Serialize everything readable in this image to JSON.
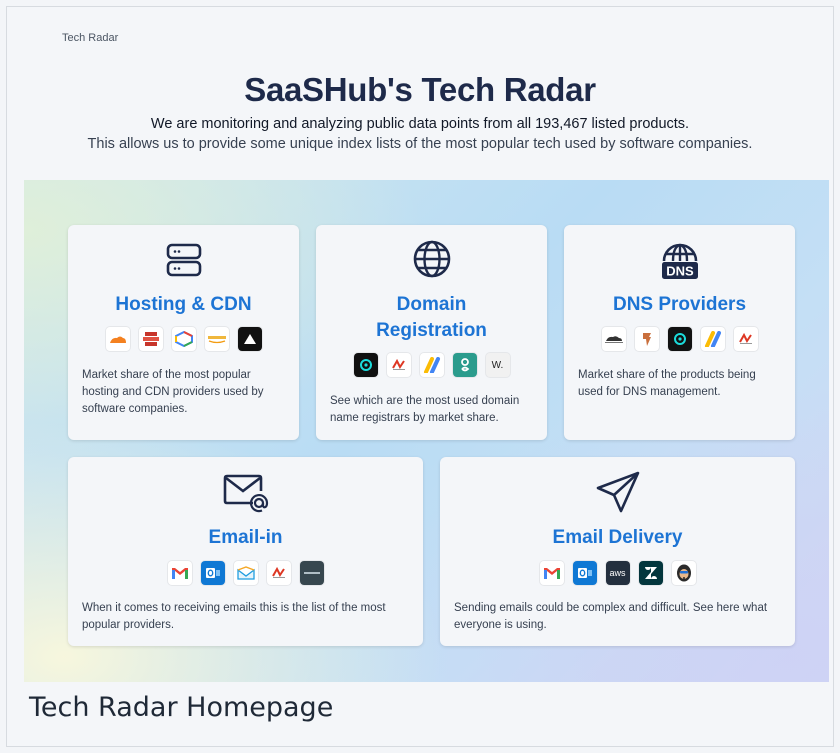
{
  "breadcrumb": "Tech Radar",
  "hero": {
    "title": "SaaSHub's Tech Radar",
    "subtitle1": "We are monitoring and analyzing public data points from all 193,467 listed products.",
    "subtitle2": "This allows us to provide some unique index lists of the most popular tech used by software companies."
  },
  "cards": {
    "hosting": {
      "icon": "server-icon",
      "title": "Hosting & CDN",
      "logos": [
        "cloudflare",
        "aws-s3",
        "google-cloud",
        "amazon-web-services",
        "vercel"
      ],
      "desc": "Market share of the most popular hosting and CDN providers used by software companies."
    },
    "domain": {
      "icon": "globe-icon",
      "title_line1": "Domain",
      "title_line2": "Registration",
      "logos": [
        "godaddy",
        "namecheap",
        "google-domains",
        "gandi",
        "w-registrar"
      ],
      "logo_w_text": "W.",
      "desc": "See which are the most used domain name registrars by market share."
    },
    "dns": {
      "icon": "dns-globe-icon",
      "icon_text": "DNS",
      "title": "DNS Providers",
      "logos": [
        "cloudflare",
        "linode",
        "godaddy",
        "google-domains",
        "namecheap"
      ],
      "desc": "Market share of the products being used for DNS management."
    },
    "email_in": {
      "icon": "email-at-icon",
      "title": "Email-in",
      "logos": [
        "gmail",
        "outlook",
        "protonmail",
        "namecheap",
        "proofpoint"
      ],
      "desc": "When it comes to receiving emails this is the list of the most popular providers."
    },
    "email_delivery": {
      "icon": "paper-plane-icon",
      "title": "Email Delivery",
      "logos": [
        "gmail",
        "outlook",
        "aws",
        "zendesk",
        "mailchimp"
      ],
      "logo_aws_text": "aws",
      "desc": "Sending emails could be complex and difficult. See here what everyone is using."
    }
  },
  "caption": "Tech Radar Homepage",
  "colors": {
    "accent": "#1d74d4",
    "heading": "#1e2a4a"
  }
}
